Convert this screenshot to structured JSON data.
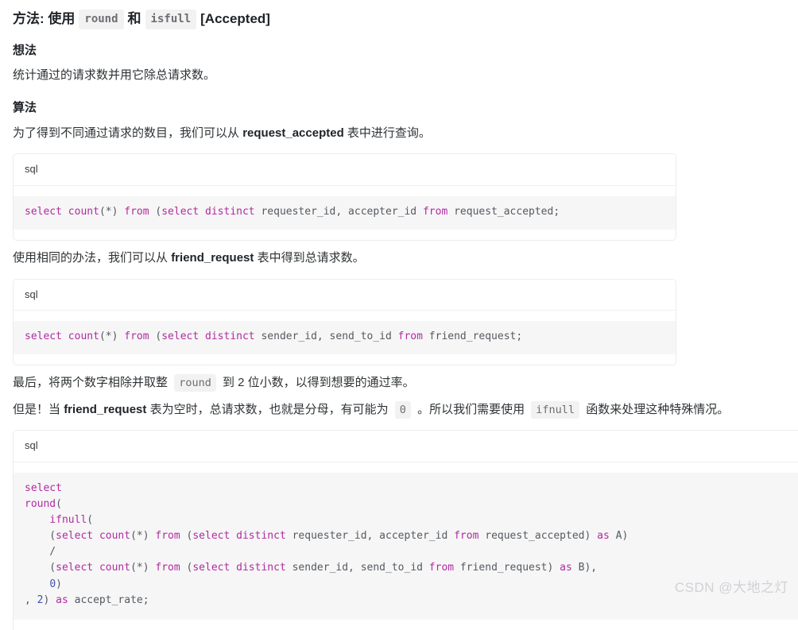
{
  "colors": {
    "keyword": "#b12ba0",
    "number": "#3f51b5",
    "code_text": "#555a60",
    "code_bg": "#f6f6f6",
    "chip_bg": "#f2f2f3",
    "watermark": "#cfd2d6",
    "text": "#2f3336"
  },
  "title": {
    "prefix": "方法: 使用",
    "code1": "round",
    "conjunction": "和",
    "code2": "isfull",
    "suffix": "[Accepted]"
  },
  "sections": {
    "idea_heading": "想法",
    "idea_paragraph": "统计通过的请求数并用它除总请求数。",
    "algo_heading": "算法",
    "algo_paragraph_1_before": "为了得到不同通过请求的数目，我们可以从",
    "algo_paragraph_1_bold": "request_accepted",
    "algo_paragraph_1_after": "表中进行查询。",
    "algo_paragraph_2_before": "使用相同的办法，我们可以从",
    "algo_paragraph_2_bold": "friend_request",
    "algo_paragraph_2_after": "表中得到总请求数。",
    "algo_paragraph_3_before": "最后，将两个数字相除并取整",
    "algo_paragraph_3_code": "round",
    "algo_paragraph_3_after": "到 2 位小数，以得到想要的通过率。",
    "algo_paragraph_4_a": "但是！当",
    "algo_paragraph_4_bold": "friend_request",
    "algo_paragraph_4_b": "表为空时，总请求数，也就是分母，有可能为",
    "algo_paragraph_4_code_zero": "0",
    "algo_paragraph_4_c": "。所以我们需要使用",
    "algo_paragraph_4_code_ifnull": "ifnull",
    "algo_paragraph_4_d": "函数来处理这种特殊情况。"
  },
  "code_blocks": [
    {
      "lang": "sql",
      "lines": [
        [
          {
            "t": "select",
            "c": "kw"
          },
          {
            "t": " ",
            "c": "plain"
          },
          {
            "t": "count",
            "c": "kw"
          },
          {
            "t": "(*) ",
            "c": "plain"
          },
          {
            "t": "from",
            "c": "kw"
          },
          {
            "t": " (",
            "c": "plain"
          },
          {
            "t": "select",
            "c": "kw"
          },
          {
            "t": " ",
            "c": "plain"
          },
          {
            "t": "distinct",
            "c": "kw"
          },
          {
            "t": " requester_id, accepter_id ",
            "c": "plain"
          },
          {
            "t": "from",
            "c": "kw"
          },
          {
            "t": " request_accepted;",
            "c": "plain"
          }
        ]
      ]
    },
    {
      "lang": "sql",
      "lines": [
        [
          {
            "t": "select",
            "c": "kw"
          },
          {
            "t": " ",
            "c": "plain"
          },
          {
            "t": "count",
            "c": "kw"
          },
          {
            "t": "(*) ",
            "c": "plain"
          },
          {
            "t": "from",
            "c": "kw"
          },
          {
            "t": " (",
            "c": "plain"
          },
          {
            "t": "select",
            "c": "kw"
          },
          {
            "t": " ",
            "c": "plain"
          },
          {
            "t": "distinct",
            "c": "kw"
          },
          {
            "t": " sender_id, send_to_id ",
            "c": "plain"
          },
          {
            "t": "from",
            "c": "kw"
          },
          {
            "t": " friend_request;",
            "c": "plain"
          }
        ]
      ]
    },
    {
      "lang": "sql",
      "lines": [
        [
          {
            "t": "select",
            "c": "kw"
          }
        ],
        [
          {
            "t": "round",
            "c": "kw"
          },
          {
            "t": "(",
            "c": "plain"
          }
        ],
        [
          {
            "t": "    ",
            "c": "plain"
          },
          {
            "t": "ifnull",
            "c": "kw"
          },
          {
            "t": "(",
            "c": "plain"
          }
        ],
        [
          {
            "t": "    (",
            "c": "plain"
          },
          {
            "t": "select",
            "c": "kw"
          },
          {
            "t": " ",
            "c": "plain"
          },
          {
            "t": "count",
            "c": "kw"
          },
          {
            "t": "(*) ",
            "c": "plain"
          },
          {
            "t": "from",
            "c": "kw"
          },
          {
            "t": " (",
            "c": "plain"
          },
          {
            "t": "select",
            "c": "kw"
          },
          {
            "t": " ",
            "c": "plain"
          },
          {
            "t": "distinct",
            "c": "kw"
          },
          {
            "t": " requester_id, accepter_id ",
            "c": "plain"
          },
          {
            "t": "from",
            "c": "kw"
          },
          {
            "t": " request_accepted) ",
            "c": "plain"
          },
          {
            "t": "as",
            "c": "kw"
          },
          {
            "t": " A)",
            "c": "plain"
          }
        ],
        [
          {
            "t": "    /",
            "c": "plain"
          }
        ],
        [
          {
            "t": "    (",
            "c": "plain"
          },
          {
            "t": "select",
            "c": "kw"
          },
          {
            "t": " ",
            "c": "plain"
          },
          {
            "t": "count",
            "c": "kw"
          },
          {
            "t": "(*) ",
            "c": "plain"
          },
          {
            "t": "from",
            "c": "kw"
          },
          {
            "t": " (",
            "c": "plain"
          },
          {
            "t": "select",
            "c": "kw"
          },
          {
            "t": " ",
            "c": "plain"
          },
          {
            "t": "distinct",
            "c": "kw"
          },
          {
            "t": " sender_id, send_to_id ",
            "c": "plain"
          },
          {
            "t": "from",
            "c": "kw"
          },
          {
            "t": " friend_request) ",
            "c": "plain"
          },
          {
            "t": "as",
            "c": "kw"
          },
          {
            "t": " B),",
            "c": "plain"
          }
        ],
        [
          {
            "t": "    ",
            "c": "plain"
          },
          {
            "t": "0",
            "c": "num"
          },
          {
            "t": ")",
            "c": "plain"
          }
        ],
        [
          {
            "t": ", ",
            "c": "plain"
          },
          {
            "t": "2",
            "c": "num"
          },
          {
            "t": ") ",
            "c": "plain"
          },
          {
            "t": "as",
            "c": "kw"
          },
          {
            "t": " accept_rate;",
            "c": "plain"
          }
        ]
      ]
    }
  ],
  "watermark": "CSDN @大地之灯"
}
